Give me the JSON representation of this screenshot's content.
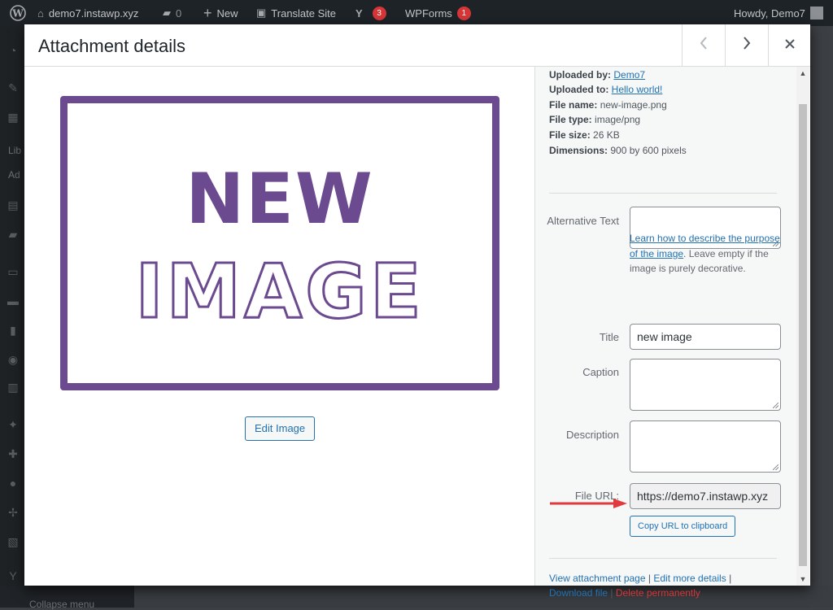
{
  "adminbar": {
    "site": "demo7.instawp.xyz",
    "comments_count": "0",
    "new_label": "New",
    "translate_label": "Translate Site",
    "yoast_count": "3",
    "wpforms_label": "WPForms",
    "wpforms_count": "1",
    "howdy": "Howdy, Demo7"
  },
  "sidemenu": {
    "partial_1": "Lib",
    "partial_2": "Ad",
    "bottom": "Collapse menu"
  },
  "modal": {
    "title": "Attachment details",
    "prev_icon": "chevron-left-icon",
    "next_icon": "chevron-right-icon",
    "close_icon": "close-icon"
  },
  "preview": {
    "image_text_1": "NEW",
    "image_text_2": "IMAGE",
    "edit_button": "Edit Image"
  },
  "details": {
    "uploaded_by_label": "Uploaded by:",
    "uploaded_by_value": "Demo7",
    "uploaded_to_label": "Uploaded to:",
    "uploaded_to_value": "Hello world!",
    "file_name_label": "File name:",
    "file_name_value": "new-image.png",
    "file_type_label": "File type:",
    "file_type_value": "image/png",
    "file_size_label": "File size:",
    "file_size_value": "26 KB",
    "dimensions_label": "Dimensions:",
    "dimensions_value": "900 by 600 pixels",
    "alt_text_label": "Alternative Text",
    "alt_text_value": "",
    "help_link": "Learn how to describe the purpose of the image",
    "help_rest": ". Leave empty if the image is purely decorative.",
    "title_label": "Title",
    "title_value": "new image",
    "caption_label": "Caption",
    "caption_value": "",
    "description_label": "Description",
    "description_value": "",
    "file_url_label": "File URL:",
    "file_url_value": "https://demo7.instawp.xyz",
    "copy_button": "Copy URL to clipboard",
    "view_page": "View attachment page",
    "edit_more": "Edit more details",
    "download": "Download file",
    "delete": "Delete permanently",
    "separator": "|"
  },
  "colors": {
    "accent": "#2271b1",
    "danger": "#d63638",
    "image_purple": "#6b4a8f",
    "annotation_red": "#e0393e"
  }
}
